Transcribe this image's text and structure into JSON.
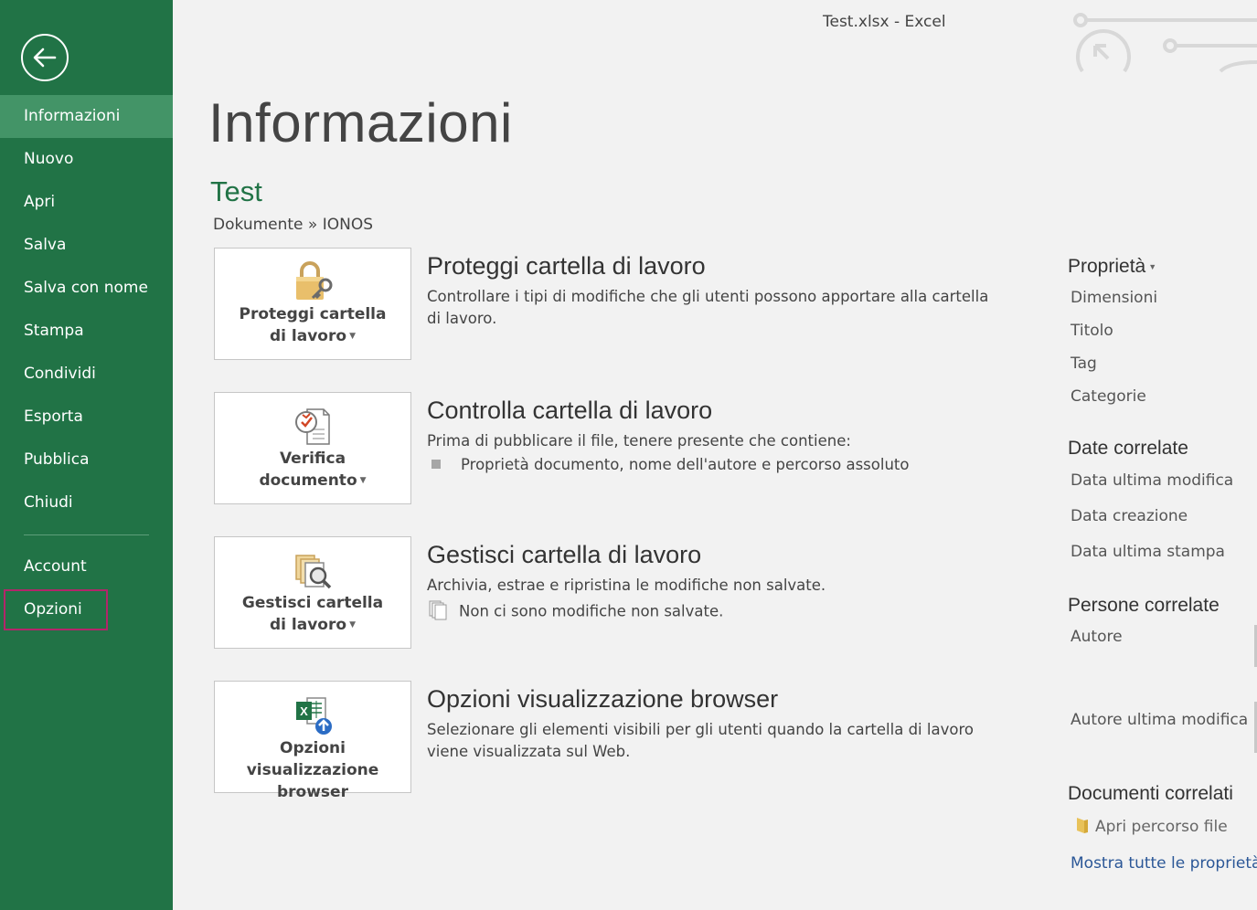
{
  "window": {
    "title": "Test.xlsx - Excel"
  },
  "sidebar": {
    "items": [
      {
        "label": "Informazioni"
      },
      {
        "label": "Nuovo"
      },
      {
        "label": "Apri"
      },
      {
        "label": "Salva"
      },
      {
        "label": "Salva con nome"
      },
      {
        "label": "Stampa"
      },
      {
        "label": "Condividi"
      },
      {
        "label": "Esporta"
      },
      {
        "label": "Pubblica"
      },
      {
        "label": "Chiudi"
      }
    ],
    "bottom_items": [
      {
        "label": "Account"
      },
      {
        "label": "Opzioni"
      }
    ],
    "active": "Informazioni",
    "highlighted": "Opzioni"
  },
  "main": {
    "page_title": "Informazioni",
    "doc_name": "Test",
    "doc_path": "Dokumente » IONOS",
    "sections": [
      {
        "tile_line1": "Proteggi cartella",
        "tile_line2": "di lavoro",
        "icon": "lock-key-icon",
        "title": "Proteggi cartella di lavoro",
        "desc": "Controllare i tipi di modifiche che gli utenti possono apportare alla cartella di lavoro."
      },
      {
        "tile_line1": "Verifica",
        "tile_line2": "documento",
        "icon": "inspect-document-icon",
        "title": "Controlla cartella di lavoro",
        "desc": "Prima di pubblicare il file, tenere presente che contiene:",
        "bullet": "Proprietà documento, nome dell'autore e percorso assoluto"
      },
      {
        "tile_line1": "Gestisci cartella",
        "tile_line2": "di lavoro",
        "icon": "manage-versions-icon",
        "title": "Gestisci cartella di lavoro",
        "desc": "Archivia, estrae e ripristina le modifiche non salvate.",
        "bullet": "Non ci sono modifiche non salvate."
      },
      {
        "tile_line1": "Opzioni visualizzazione",
        "tile_line2": "browser",
        "icon": "excel-browser-view-icon",
        "title": "Opzioni visualizzazione browser",
        "desc": "Selezionare gli elementi visibili per gli utenti quando la cartella di lavoro viene visualizzata sul Web."
      }
    ]
  },
  "properties": {
    "heading": "Proprietà",
    "items": [
      "Dimensioni",
      "Titolo",
      "Tag",
      "Categorie"
    ],
    "dates_heading": "Date correlate",
    "dates": [
      "Data ultima modifica",
      "Data creazione",
      "Data ultima stampa"
    ],
    "people_heading": "Persone correlate",
    "people": [
      "Autore",
      "Autore ultima modifica"
    ],
    "docs_heading": "Documenti correlati",
    "open_path": "Apri percorso file",
    "show_all": "Mostra tutte le proprietà"
  },
  "colors": {
    "sidebar": "#217346",
    "sidebar_active": "#439467",
    "accent_green": "#217346",
    "highlight_border": "#b3256a",
    "link": "#2b5797"
  }
}
